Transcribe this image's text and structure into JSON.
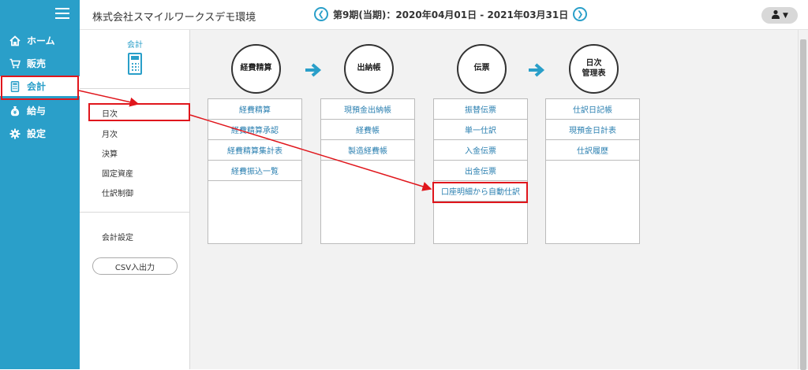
{
  "header": {
    "company": "株式会社スマイルワークスデモ環境",
    "period": "第9期(当期)：2020年04月01日 - 2021年03月31日",
    "prev_icon": "chevron-left-icon",
    "next_icon": "chevron-right-icon",
    "user_icon": "user-icon"
  },
  "leftnav": {
    "items": [
      {
        "label": "ホーム",
        "icon": "home-icon"
      },
      {
        "label": "販売",
        "icon": "cart-icon"
      },
      {
        "label": "会計",
        "icon": "calculator-icon",
        "active": true
      },
      {
        "label": "給与",
        "icon": "money-bag-icon"
      },
      {
        "label": "設定",
        "icon": "gear-icon"
      }
    ]
  },
  "subnav": {
    "title": "会計",
    "items": [
      "日次",
      "月次",
      "決算",
      "固定資産",
      "仕訳制御"
    ],
    "settings": "会計設定",
    "csv_button": "CSV入出力"
  },
  "categories": [
    {
      "label": "経費精算",
      "items": [
        "経費精算",
        "経費精算承認",
        "経費精算集計表",
        "経費振込一覧"
      ]
    },
    {
      "label": "出納帳",
      "items": [
        "現預金出納帳",
        "経費帳",
        "製造経費帳"
      ]
    },
    {
      "label": "伝票",
      "items": [
        "振替伝票",
        "単一仕訳",
        "入金伝票",
        "出金伝票",
        "口座明細から自動仕訳"
      ]
    },
    {
      "label": "日次管理表",
      "label_lines": [
        "日次",
        "管理表"
      ],
      "items": [
        "仕訳日記帳",
        "現預金日計表",
        "仕訳履歴"
      ]
    }
  ],
  "colors": {
    "brand": "#2a9fc9",
    "annotation": "#e0161c"
  }
}
